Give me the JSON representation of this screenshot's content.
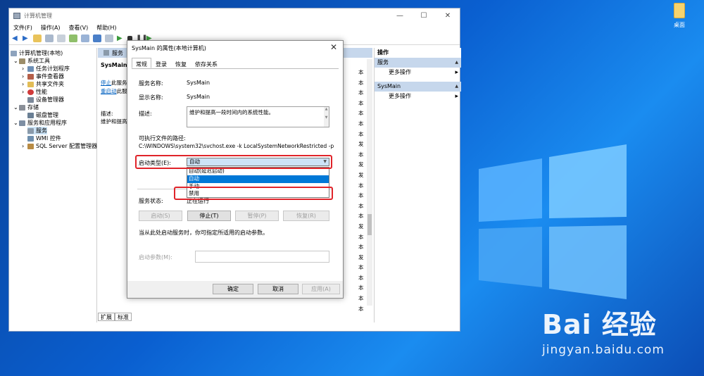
{
  "desktop": {
    "icon_label": "桌面",
    "watermark_brand": "Bai 经验",
    "watermark_url": "jingyan.baidu.com"
  },
  "window": {
    "title": "计算机管理",
    "menu": [
      "文件(F)",
      "操作(A)",
      "查看(V)",
      "帮助(H)"
    ],
    "controls": {
      "minimize": "—",
      "maximize": "☐",
      "close": "✕"
    }
  },
  "tree": {
    "root": "计算机管理(本地)",
    "system_tools": "系统工具",
    "task_scheduler": "任务计划程序",
    "event_viewer": "事件查看器",
    "shared_folders": "共享文件夹",
    "performance": "性能",
    "device_manager": "设备管理器",
    "storage": "存储",
    "disk_management": "磁盘管理",
    "services_apps": "服务和应用程序",
    "services": "服务",
    "wmi": "WMI 控件",
    "sql": "SQL Server 配置管理器"
  },
  "center": {
    "header": "服务",
    "service_name": "SysMain",
    "stop_link": "停止",
    "stop_suffix": "此服务",
    "restart_link": "重启动",
    "restart_suffix": "此服",
    "description_label": "描述:",
    "description_text": "维护和提高",
    "status_column": [
      "本",
      "本",
      "本",
      "本",
      "本",
      "本",
      "本",
      "发",
      "本",
      "发",
      "发",
      "本",
      "本",
      "本",
      "本",
      "发",
      "本",
      "本",
      "发",
      "本",
      "本",
      "本",
      "本",
      "本"
    ],
    "bottom_tabs": [
      "扩展",
      "标准"
    ]
  },
  "actions": {
    "header": "操作",
    "section1": "服务",
    "more1": "更多操作",
    "section2": "SysMain",
    "more2": "更多操作"
  },
  "dialog": {
    "title": "SysMain 的属性(本地计算机)",
    "tabs": [
      "常规",
      "登录",
      "恢复",
      "依存关系"
    ],
    "service_name_label": "服务名称:",
    "service_name_value": "SysMain",
    "display_name_label": "显示名称:",
    "display_name_value": "SysMain",
    "description_label": "描述:",
    "description_value": "维护和提高一段时间内的系统性能。",
    "path_label": "可执行文件的路径:",
    "path_value": "C:\\WINDOWS\\system32\\svchost.exe -k LocalSystemNetworkRestricted -p",
    "startup_type_label": "启动类型(E):",
    "startup_type_value": "自动",
    "startup_options": [
      "自动(延迟启动)",
      "自动",
      "手动",
      "禁用"
    ],
    "startup_highlighted_index": 1,
    "status_label": "服务状态:",
    "status_value": "正在运行",
    "start_btn": "启动(S)",
    "stop_btn": "停止(T)",
    "pause_btn": "暂停(P)",
    "resume_btn": "恢复(R)",
    "hint": "当从此处启动服务时，你可指定所适用的启动参数。",
    "params_label": "启动参数(M):",
    "ok_btn": "确定",
    "cancel_btn": "取消",
    "apply_btn": "应用(A)",
    "annotation_color": "#e0242a"
  }
}
